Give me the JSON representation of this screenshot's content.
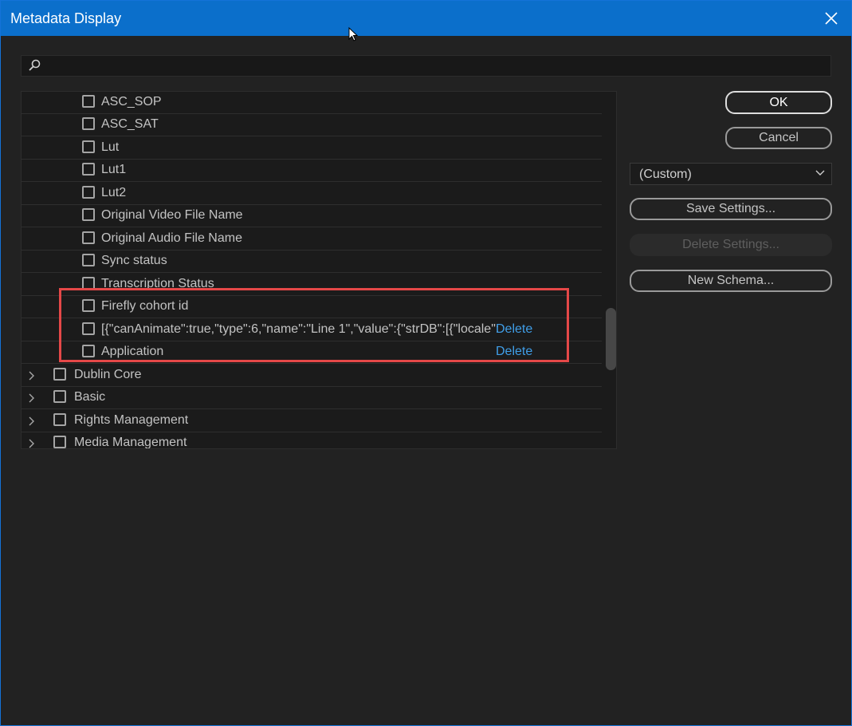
{
  "window": {
    "title": "Metadata Display"
  },
  "search": {
    "placeholder": "",
    "value": ""
  },
  "list": {
    "items": [
      {
        "label": "ASC_SOP"
      },
      {
        "label": "ASC_SAT"
      },
      {
        "label": "Lut"
      },
      {
        "label": "Lut1"
      },
      {
        "label": "Lut2"
      },
      {
        "label": "Original Video File Name"
      },
      {
        "label": "Original Audio File Name"
      },
      {
        "label": "Sync status"
      },
      {
        "label": "Transcription Status"
      },
      {
        "label": "Firefly cohort id"
      },
      {
        "label": "[{\"canAnimate\":true,\"type\":6,\"name\":\"Line 1\",\"value\":{\"strDB\":[{\"locale\":",
        "delete_label": "Delete"
      },
      {
        "label": "Application",
        "delete_label": "Delete"
      }
    ],
    "groups": [
      {
        "label": "Dublin Core"
      },
      {
        "label": "Basic"
      },
      {
        "label": "Rights Management"
      },
      {
        "label": "Media Management"
      }
    ]
  },
  "buttons": {
    "ok": "OK",
    "cancel": "Cancel",
    "save_settings": "Save Settings...",
    "delete_settings": "Delete Settings...",
    "new_schema": "New Schema..."
  },
  "preset": {
    "selected": "(Custom)"
  },
  "colors": {
    "titlebar": "#0b6fcb",
    "link": "#3f9ee8",
    "highlight": "#e54848"
  }
}
